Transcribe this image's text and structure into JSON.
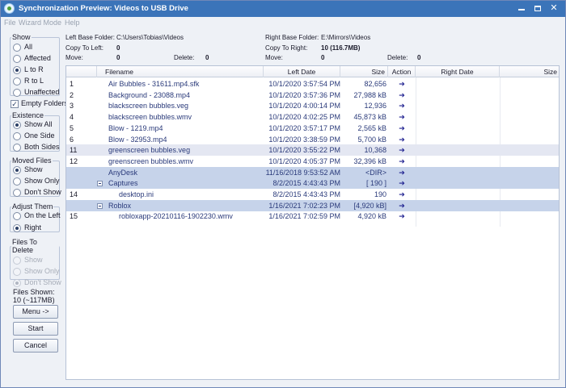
{
  "window": {
    "title": "Synchronization Preview: Videos to USB Drive",
    "controls": {
      "minimize": "—",
      "close": "✕"
    }
  },
  "menu": [
    "File",
    "Wizard Mode",
    "Help"
  ],
  "left_panel": {
    "show": {
      "legend": "Show",
      "options": [
        "All",
        "Affected",
        "L to R",
        "R to L",
        "Unaffected"
      ],
      "selected": "L to R"
    },
    "empty_folders": {
      "label": "Empty Folders",
      "checked": true,
      "mark": "✓"
    },
    "existence": {
      "legend": "Existence",
      "options": [
        "Show All",
        "One Side",
        "Both Sides"
      ],
      "selected": "Show All"
    },
    "moved_files": {
      "legend": "Moved Files",
      "options": [
        "Show",
        "Show Only",
        "Don't Show"
      ],
      "selected": "Show"
    },
    "adjust_them": {
      "legend": "Adjust Them",
      "options": [
        "On the Left",
        "Right"
      ],
      "selected": "Right"
    },
    "files_to_delete": {
      "legend": "Files To Delete",
      "options": [
        "Show",
        "Show Only",
        "Don't Show"
      ],
      "selected": "Don't Show",
      "disabled": true
    },
    "files_shown": {
      "label": "Files Shown:",
      "value": "10 (~117MB)"
    },
    "buttons": {
      "menu": "Menu ->",
      "start": "Start",
      "cancel": "Cancel"
    }
  },
  "header": {
    "left_base_label": "Left Base Folder:",
    "left_base_value": "C:\\Users\\Tobias\\Videos",
    "right_base_label": "Right Base Folder:",
    "right_base_value": "E:\\Mirrors\\Videos",
    "copy_to_left_label": "Copy To Left:",
    "copy_to_left_value": "0",
    "copy_to_right_label": "Copy To Right:",
    "copy_to_right_value": "10 (116.7MB)",
    "move_left_label": "Move:",
    "move_left_value": "0",
    "delete_left_label": "Delete:",
    "delete_left_value": "0",
    "move_right_label": "Move:",
    "move_right_value": "0",
    "delete_right_label": "Delete:",
    "delete_right_value": "0"
  },
  "table": {
    "columns": [
      "Filename",
      "Left Date",
      "Size",
      "Action",
      "Right Date",
      "Size"
    ],
    "rows": [
      {
        "num": "1",
        "name": "Air Bubbles - 31611.mp4.sfk",
        "date": "10/1/2020 3:57:54 PM",
        "size": "82,656",
        "action": "➔",
        "type": "file",
        "indent": 0
      },
      {
        "num": "2",
        "name": "Background - 23088.mp4",
        "date": "10/1/2020 3:57:36 PM",
        "size": "27,988 kB",
        "action": "➔",
        "type": "file",
        "indent": 0
      },
      {
        "num": "3",
        "name": "blackscreen bubbles.veg",
        "date": "10/1/2020 4:00:14 PM",
        "size": "12,936",
        "action": "➔",
        "type": "file",
        "indent": 0
      },
      {
        "num": "4",
        "name": "blackscreen bubbles.wmv",
        "date": "10/1/2020 4:02:25 PM",
        "size": "45,873 kB",
        "action": "➔",
        "type": "file",
        "indent": 0
      },
      {
        "num": "5",
        "name": "Blow - 1219.mp4",
        "date": "10/1/2020 3:57:17 PM",
        "size": "2,565 kB",
        "action": "➔",
        "type": "file",
        "indent": 0
      },
      {
        "num": "6",
        "name": "Blow - 32953.mp4",
        "date": "10/1/2020 3:38:59 PM",
        "size": "5,700 kB",
        "action": "➔",
        "type": "file",
        "indent": 0
      },
      {
        "num": "11",
        "name": "greenscreen bubbles.veg",
        "date": "10/1/2020 3:55:22 PM",
        "size": "10,368",
        "action": "➔",
        "type": "file",
        "indent": 0,
        "selected": true
      },
      {
        "num": "12",
        "name": "greenscreen bubbles.wmv",
        "date": "10/1/2020 4:05:37 PM",
        "size": "32,396 kB",
        "action": "➔",
        "type": "file",
        "indent": 0
      },
      {
        "num": "",
        "name": "AnyDesk",
        "date": "11/16/2018 9:53:52 AM",
        "size": "<DIR>",
        "action": "➔",
        "type": "folder",
        "indent": 0,
        "expander": false
      },
      {
        "num": "",
        "name": "Captures",
        "date": "8/2/2015 4:43:43 PM",
        "size": "[ 190 ]",
        "action": "➔",
        "type": "folder",
        "indent": 0,
        "expander": true
      },
      {
        "num": "14",
        "name": "desktop.ini",
        "date": "8/2/2015 4:43:43 PM",
        "size": "190",
        "action": "➔",
        "type": "file",
        "indent": 1
      },
      {
        "num": "",
        "name": "Roblox",
        "date": "1/16/2021 7:02:23 PM",
        "size": "[4,920 kB]",
        "action": "➔",
        "type": "folder",
        "indent": 0,
        "expander": true
      },
      {
        "num": "15",
        "name": "robloxapp-20210116-1902230.wmv",
        "date": "1/16/2021 7:02:59 PM",
        "size": "4,920 kB",
        "action": "➔",
        "type": "file",
        "indent": 1
      }
    ]
  },
  "colors": {
    "titlebar": "#3b74b9",
    "folder_row": "#c6d3ea",
    "selected_row": "#e4e7f2",
    "action_arrow": "#1d1f8f"
  }
}
